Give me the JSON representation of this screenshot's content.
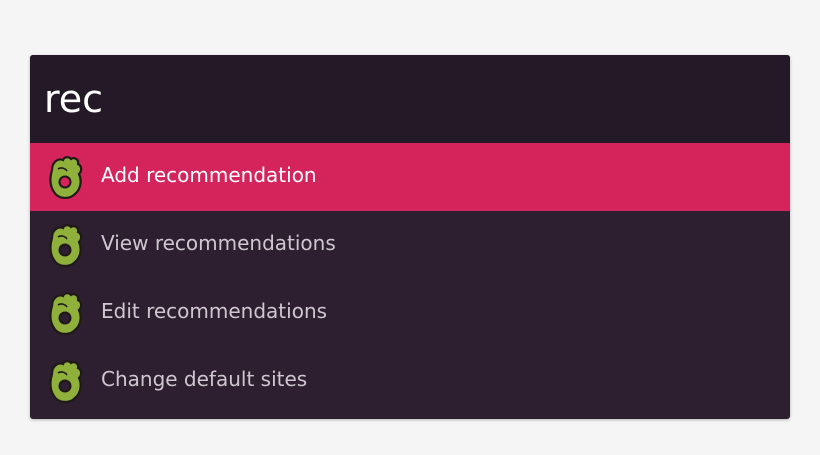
{
  "search": {
    "query": "rec"
  },
  "results": [
    {
      "label": "Add recommendation",
      "icon": "ok-hand-icon",
      "selected": true
    },
    {
      "label": "View recommendations",
      "icon": "ok-hand-icon",
      "selected": false
    },
    {
      "label": "Edit recommendations",
      "icon": "ok-hand-icon",
      "selected": false
    },
    {
      "label": "Change default sites",
      "icon": "ok-hand-icon",
      "selected": false
    }
  ],
  "colors": {
    "panel_background": "#2d1e30",
    "query_background": "#241a27",
    "selected_row": "#d4245b",
    "icon_green": "#8fb03a",
    "icon_outline": "#1f1a17"
  }
}
